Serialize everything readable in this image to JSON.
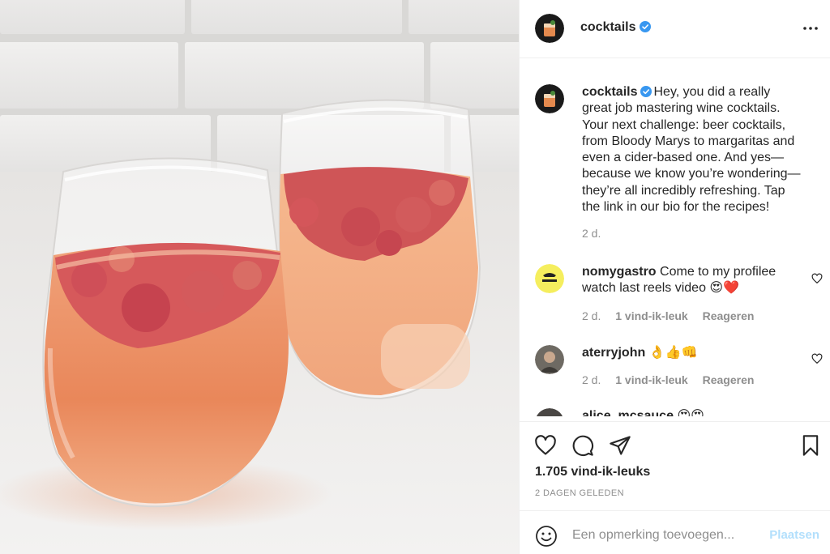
{
  "post": {
    "image_alt": "Two glasses of pink cocktail with crushed raspberries",
    "author": "cocktails",
    "verified": true,
    "more_icon": "more-options-icon"
  },
  "caption": {
    "username": "cocktails",
    "lines": [
      "Hey, you did a really",
      "great job mastering wine cocktails.",
      "Your next challenge: beer cocktails,",
      "from Bloody Marys to margaritas and",
      "even a cider-based one. And yes—",
      "because we know you’re wondering—",
      "they’re all incredibly refreshing. Tap",
      "the link in our bio for the recipes!"
    ],
    "time": "2 d."
  },
  "comments": [
    {
      "username": "nomygastro",
      "lines": [
        "Come to my profilee",
        "watch last reels video 😍❤️"
      ],
      "time": "2 d.",
      "likes": "1 vind-ik-leuk",
      "reply": "Reageren"
    },
    {
      "username": "aterryjohn",
      "lines": [
        "👌👍👊"
      ],
      "time": "2 d.",
      "likes": "1 vind-ik-leuk",
      "reply": "Reageren"
    },
    {
      "username": "alice_mcsauce",
      "lines": [
        "😍😍"
      ],
      "time": "",
      "likes": "",
      "reply": ""
    }
  ],
  "actions": {
    "likes_count": "1.705 vind-ik-leuks",
    "posted": "2 DAGEN GELEDEN"
  },
  "add_comment": {
    "placeholder": "Een opmerking toevoegen...",
    "post_label": "Plaatsen"
  },
  "colors": {
    "verified_blue": "#3897f0",
    "heart_red": "#ed4956",
    "post_button_disabled": "#b2dffc",
    "secondary_text": "#8e8e8e",
    "primary_text": "#262626"
  }
}
